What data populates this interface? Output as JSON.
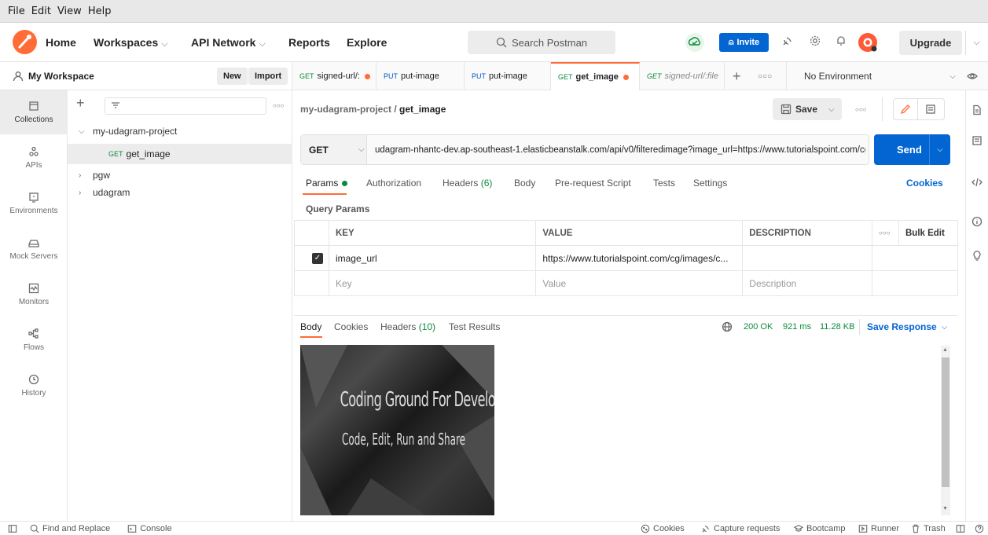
{
  "os_menu": [
    "File",
    "Edit",
    "View",
    "Help"
  ],
  "header": {
    "nav": [
      {
        "label": "Home",
        "chevron": false
      },
      {
        "label": "Workspaces",
        "chevron": true
      },
      {
        "label": "API Network",
        "chevron": true
      },
      {
        "label": "Reports",
        "chevron": false
      },
      {
        "label": "Explore",
        "chevron": false
      }
    ],
    "search_placeholder": "Search Postman",
    "invite_label": "Invite",
    "upgrade_label": "Upgrade"
  },
  "workspace": {
    "name": "My Workspace",
    "new_label": "New",
    "import_label": "Import"
  },
  "tabs": [
    {
      "method": "GET",
      "name": "signed-url/:",
      "dot": true,
      "active": false
    },
    {
      "method": "PUT",
      "name": "put-image",
      "dot": false,
      "active": false
    },
    {
      "method": "PUT",
      "name": "put-image",
      "dot": false,
      "active": false
    },
    {
      "method": "GET",
      "name": "get_image",
      "dot": true,
      "active": true
    },
    {
      "method": "GET",
      "name": "signed-url/:file",
      "dot": false,
      "active": false
    }
  ],
  "environment": "No Environment",
  "rail": [
    {
      "label": "Collections",
      "icon": "collections-icon",
      "active": true
    },
    {
      "label": "APIs",
      "icon": "apis-icon",
      "active": false
    },
    {
      "label": "Environments",
      "icon": "environments-icon",
      "active": false
    },
    {
      "label": "Mock Servers",
      "icon": "mock-servers-icon",
      "active": false
    },
    {
      "label": "Monitors",
      "icon": "monitors-icon",
      "active": false
    },
    {
      "label": "Flows",
      "icon": "flows-icon",
      "active": false
    },
    {
      "label": "History",
      "icon": "history-icon",
      "active": false
    }
  ],
  "tree": {
    "collection": "my-udagram-project",
    "request_method": "GET",
    "request_name": "get_image",
    "others": [
      "pgw",
      "udagram"
    ]
  },
  "request": {
    "breadcrumb_parent": "my-udagram-project",
    "breadcrumb_name": "get_image",
    "save_label": "Save",
    "method": "GET",
    "url": "udagram-nhantc-dev.ap-southeast-1.elasticbeanstalk.com/api/v0/filteredimage?image_url=https://www.tutorialspoint.com/cg/images/cgbanner.jpg",
    "send_label": "Send",
    "tabs": {
      "params": "Params",
      "authorization": "Authorization",
      "headers": "Headers",
      "headers_count": "(6)",
      "body": "Body",
      "prerequest": "Pre-request Script",
      "tests": "Tests",
      "settings": "Settings"
    },
    "cookies_label": "Cookies",
    "query_params_label": "Query Params",
    "columns": {
      "key": "KEY",
      "value": "VALUE",
      "description": "DESCRIPTION",
      "bulk_edit": "Bulk Edit"
    },
    "param": {
      "key": "image_url",
      "value": "https://www.tutorialspoint.com/cg/images/c..."
    },
    "placeholders": {
      "key": "Key",
      "value": "Value",
      "description": "Description"
    }
  },
  "response": {
    "tabs": {
      "body": "Body",
      "cookies": "Cookies",
      "headers": "Headers",
      "headers_count": "(10)",
      "test_results": "Test Results"
    },
    "status": "200 OK",
    "time": "921 ms",
    "size": "11.28 KB",
    "save_label": "Save Response",
    "image_line1": "Coding Ground For Developers",
    "image_line2": "Code, Edit, Run and Share"
  },
  "statusbar": {
    "find_replace": "Find and Replace",
    "console": "Console",
    "cookies": "Cookies",
    "capture": "Capture requests",
    "bootcamp": "Bootcamp",
    "runner": "Runner",
    "trash": "Trash"
  },
  "colors": {
    "accent": "#ff6c37",
    "primary": "#0265d2",
    "get": "#0a8a3a",
    "put": "#0255c1"
  }
}
